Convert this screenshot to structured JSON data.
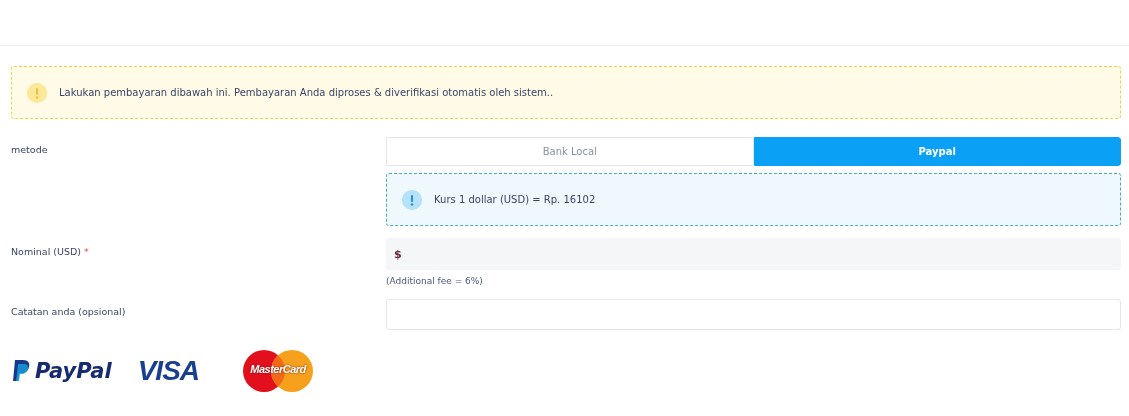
{
  "alert": {
    "text": "Lakukan pembayaran dibawah ini. Pembayaran Anda diproses & diverifikasi otomatis oleh sistem.."
  },
  "method": {
    "label": "metode",
    "tabs": [
      {
        "label": "Bank Local",
        "selected": false
      },
      {
        "label": "Paypal",
        "selected": true
      }
    ],
    "info": {
      "text": "Kurs 1 dollar (USD) = Rp. 16102"
    }
  },
  "nominal": {
    "label": "Nominal (USD)",
    "required_mark": "*",
    "prefix": "$",
    "hint": "(Additional fee = 6%)"
  },
  "note": {
    "label": "Catatan anda (opsional)"
  },
  "logos": [
    {
      "kind": "paypal",
      "text": "PayPal"
    },
    {
      "kind": "visa",
      "text": "VISA"
    },
    {
      "kind": "mastercard",
      "text": "MasterCard"
    }
  ]
}
